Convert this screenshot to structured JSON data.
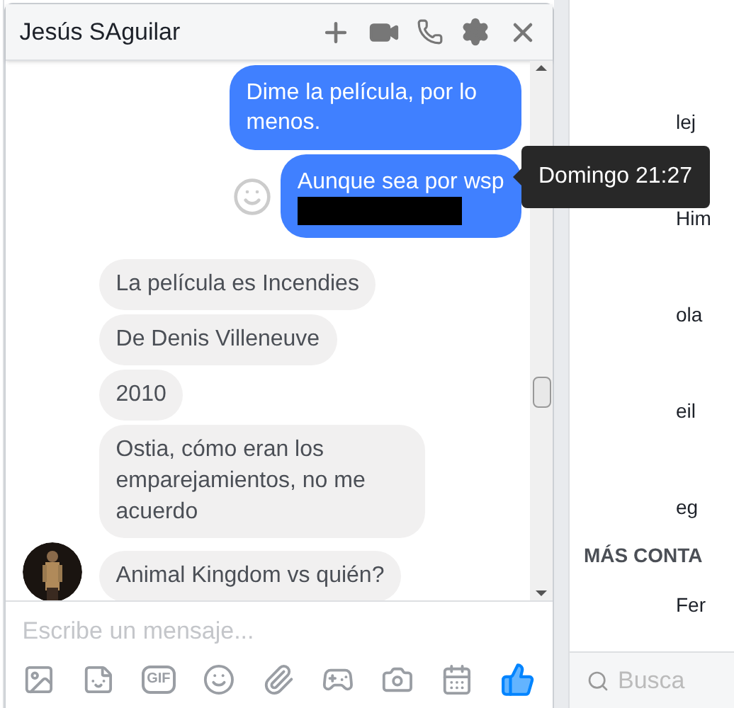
{
  "chat": {
    "title": "Jesús SAguilar",
    "messages": [
      {
        "kind": "outgoing",
        "text": "Dime la película, por lo menos."
      },
      {
        "kind": "outgoing",
        "text": "Aunque sea por wsp",
        "redacted": true,
        "react_button": true
      },
      {
        "kind": "incoming",
        "text": "La película es Incendies"
      },
      {
        "kind": "incoming",
        "text": "De Denis Villeneuve"
      },
      {
        "kind": "incoming",
        "text": "2010"
      },
      {
        "kind": "incoming",
        "text": "Ostia, cómo eran los emparejamientos, no me acuerdo"
      },
      {
        "kind": "incoming",
        "text": "Animal Kingdom vs quién?",
        "avatar": true
      }
    ],
    "tooltip": "Domingo 21:27",
    "composer": {
      "placeholder": "Escribe un mensaje...",
      "gif_label": "GIF"
    }
  },
  "sidebar": {
    "contacts": [
      "lej",
      "Him",
      "ola",
      "eil",
      "eg"
    ],
    "section_title": "MÁS CONTA",
    "more_contacts": [
      "Fer"
    ],
    "search": {
      "placeholder": "Busca"
    }
  }
}
